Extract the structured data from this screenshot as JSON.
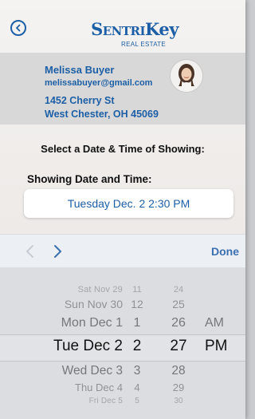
{
  "header": {
    "back_icon": "chevron-left-circle-icon",
    "logo_name_first": "S",
    "logo_name_mid": "ENTRI",
    "logo_name_last": "Key",
    "logo_sub": "REAL ESTATE"
  },
  "buyer": {
    "name": "Melissa Buyer",
    "email": "melissabuyer@gmail.com",
    "address_line1": "1452 Cherry St",
    "address_line2": "West Chester, OH 45069"
  },
  "form": {
    "select_title": "Select a Date & Time of Showing:",
    "showing_label": "Showing Date and Time:",
    "showing_value": "Tuesday Dec. 2  2:30 PM"
  },
  "toolbar": {
    "prev_icon": "chevron-left-icon",
    "next_icon": "chevron-right-icon",
    "done_label": "Done"
  },
  "picker": {
    "rows": [
      {
        "date": "Sat Nov 29",
        "hour": "11",
        "minute": "24",
        "ampm": ""
      },
      {
        "date": "Sun Nov 30",
        "hour": "12",
        "minute": "25",
        "ampm": ""
      },
      {
        "date": "Mon Dec 1",
        "hour": "1",
        "minute": "26",
        "ampm": "AM"
      },
      {
        "date": "Tue Dec 2",
        "hour": "2",
        "minute": "27",
        "ampm": "PM"
      },
      {
        "date": "Wed Dec 3",
        "hour": "3",
        "minute": "28",
        "ampm": ""
      },
      {
        "date": "Thu Dec 4",
        "hour": "4",
        "minute": "29",
        "ampm": ""
      },
      {
        "date": "Fri Dec 5",
        "hour": "5",
        "minute": "30",
        "ampm": ""
      }
    ]
  },
  "colors": {
    "brand": "#1d5fa6",
    "done": "#3b6fb0",
    "buyer_card_bg": "#d8d8d8",
    "picker_bg": "#dcdde1"
  }
}
